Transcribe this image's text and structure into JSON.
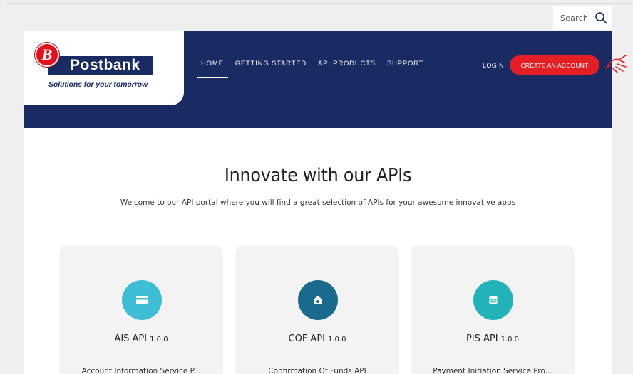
{
  "search": {
    "label": "Search"
  },
  "brand": {
    "mark": "B",
    "name": "Postbank",
    "tagline": "Solutions for your tomorrow"
  },
  "nav": {
    "items": [
      {
        "label": "HOME",
        "active": true
      },
      {
        "label": "GETTING STARTED"
      },
      {
        "label": "API PRODUCTS"
      },
      {
        "label": "SUPPORT"
      }
    ],
    "login": "LOGIN",
    "create_account": "CREATE AN ACCOUNT"
  },
  "hero": {
    "title": "Innovate with our APIs",
    "subtitle": "Welcome to our API portal where you will find a great selection of APIs for your awesome innovative apps"
  },
  "cards": [
    {
      "name": "AIS API",
      "version": "1.0.0",
      "description": "Account Information Service P...",
      "icon": "card-icon",
      "color": "#3fbcd6"
    },
    {
      "name": "COF API",
      "version": "1.0.0",
      "description": "Confirmation Of Funds API",
      "icon": "bank-icon",
      "color": "#1a6a8e"
    },
    {
      "name": "PIS API",
      "version": "1.0.0",
      "description": "Payment Initiation Service Pro...",
      "icon": "coins-icon",
      "color": "#22b3b8"
    }
  ],
  "colors": {
    "navy": "#1a2a62",
    "accent": "#e31e24"
  }
}
